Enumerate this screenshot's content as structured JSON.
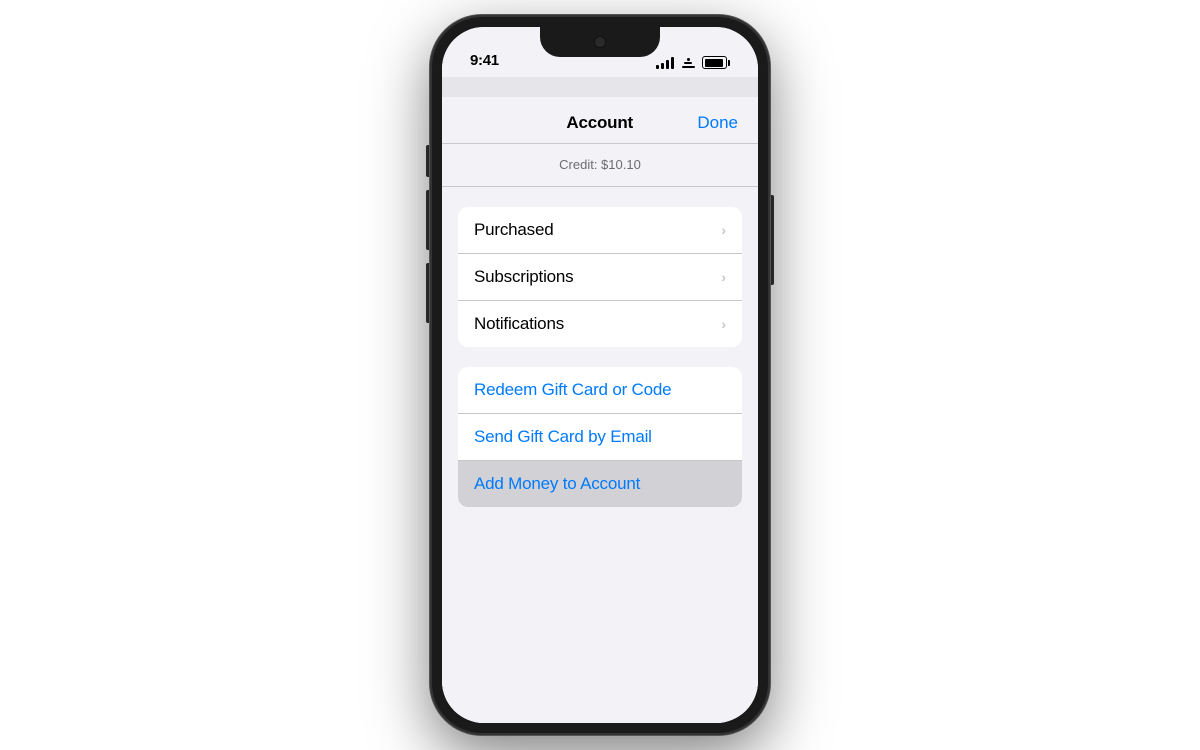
{
  "statusBar": {
    "time": "9:41",
    "icons": {
      "signal": "signal-icon",
      "wifi": "wifi-icon",
      "battery": "battery-icon"
    }
  },
  "navBar": {
    "title": "Account",
    "doneLabel": "Done"
  },
  "creditSection": {
    "text": "Credit: $10.10"
  },
  "listSection": {
    "items": [
      {
        "label": "Purchased",
        "hasChevron": true
      },
      {
        "label": "Subscriptions",
        "hasChevron": true
      },
      {
        "label": "Notifications",
        "hasChevron": true
      }
    ]
  },
  "giftSection": {
    "items": [
      {
        "label": "Redeem Gift Card or Code",
        "highlighted": false
      },
      {
        "label": "Send Gift Card by Email",
        "highlighted": false
      },
      {
        "label": "Add Money to Account",
        "highlighted": true
      }
    ]
  }
}
